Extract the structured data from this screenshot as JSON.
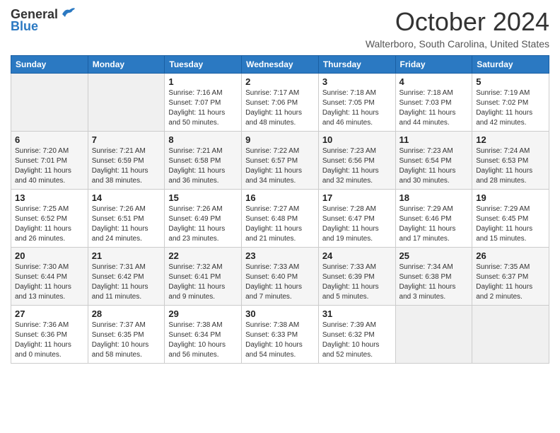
{
  "logo": {
    "general": "General",
    "blue": "Blue"
  },
  "title": "October 2024",
  "location": "Walterboro, South Carolina, United States",
  "days_of_week": [
    "Sunday",
    "Monday",
    "Tuesday",
    "Wednesday",
    "Thursday",
    "Friday",
    "Saturday"
  ],
  "weeks": [
    [
      {
        "day": "",
        "info": ""
      },
      {
        "day": "",
        "info": ""
      },
      {
        "day": "1",
        "info": "Sunrise: 7:16 AM\nSunset: 7:07 PM\nDaylight: 11 hours and 50 minutes."
      },
      {
        "day": "2",
        "info": "Sunrise: 7:17 AM\nSunset: 7:06 PM\nDaylight: 11 hours and 48 minutes."
      },
      {
        "day": "3",
        "info": "Sunrise: 7:18 AM\nSunset: 7:05 PM\nDaylight: 11 hours and 46 minutes."
      },
      {
        "day": "4",
        "info": "Sunrise: 7:18 AM\nSunset: 7:03 PM\nDaylight: 11 hours and 44 minutes."
      },
      {
        "day": "5",
        "info": "Sunrise: 7:19 AM\nSunset: 7:02 PM\nDaylight: 11 hours and 42 minutes."
      }
    ],
    [
      {
        "day": "6",
        "info": "Sunrise: 7:20 AM\nSunset: 7:01 PM\nDaylight: 11 hours and 40 minutes."
      },
      {
        "day": "7",
        "info": "Sunrise: 7:21 AM\nSunset: 6:59 PM\nDaylight: 11 hours and 38 minutes."
      },
      {
        "day": "8",
        "info": "Sunrise: 7:21 AM\nSunset: 6:58 PM\nDaylight: 11 hours and 36 minutes."
      },
      {
        "day": "9",
        "info": "Sunrise: 7:22 AM\nSunset: 6:57 PM\nDaylight: 11 hours and 34 minutes."
      },
      {
        "day": "10",
        "info": "Sunrise: 7:23 AM\nSunset: 6:56 PM\nDaylight: 11 hours and 32 minutes."
      },
      {
        "day": "11",
        "info": "Sunrise: 7:23 AM\nSunset: 6:54 PM\nDaylight: 11 hours and 30 minutes."
      },
      {
        "day": "12",
        "info": "Sunrise: 7:24 AM\nSunset: 6:53 PM\nDaylight: 11 hours and 28 minutes."
      }
    ],
    [
      {
        "day": "13",
        "info": "Sunrise: 7:25 AM\nSunset: 6:52 PM\nDaylight: 11 hours and 26 minutes."
      },
      {
        "day": "14",
        "info": "Sunrise: 7:26 AM\nSunset: 6:51 PM\nDaylight: 11 hours and 24 minutes."
      },
      {
        "day": "15",
        "info": "Sunrise: 7:26 AM\nSunset: 6:49 PM\nDaylight: 11 hours and 23 minutes."
      },
      {
        "day": "16",
        "info": "Sunrise: 7:27 AM\nSunset: 6:48 PM\nDaylight: 11 hours and 21 minutes."
      },
      {
        "day": "17",
        "info": "Sunrise: 7:28 AM\nSunset: 6:47 PM\nDaylight: 11 hours and 19 minutes."
      },
      {
        "day": "18",
        "info": "Sunrise: 7:29 AM\nSunset: 6:46 PM\nDaylight: 11 hours and 17 minutes."
      },
      {
        "day": "19",
        "info": "Sunrise: 7:29 AM\nSunset: 6:45 PM\nDaylight: 11 hours and 15 minutes."
      }
    ],
    [
      {
        "day": "20",
        "info": "Sunrise: 7:30 AM\nSunset: 6:44 PM\nDaylight: 11 hours and 13 minutes."
      },
      {
        "day": "21",
        "info": "Sunrise: 7:31 AM\nSunset: 6:42 PM\nDaylight: 11 hours and 11 minutes."
      },
      {
        "day": "22",
        "info": "Sunrise: 7:32 AM\nSunset: 6:41 PM\nDaylight: 11 hours and 9 minutes."
      },
      {
        "day": "23",
        "info": "Sunrise: 7:33 AM\nSunset: 6:40 PM\nDaylight: 11 hours and 7 minutes."
      },
      {
        "day": "24",
        "info": "Sunrise: 7:33 AM\nSunset: 6:39 PM\nDaylight: 11 hours and 5 minutes."
      },
      {
        "day": "25",
        "info": "Sunrise: 7:34 AM\nSunset: 6:38 PM\nDaylight: 11 hours and 3 minutes."
      },
      {
        "day": "26",
        "info": "Sunrise: 7:35 AM\nSunset: 6:37 PM\nDaylight: 11 hours and 2 minutes."
      }
    ],
    [
      {
        "day": "27",
        "info": "Sunrise: 7:36 AM\nSunset: 6:36 PM\nDaylight: 11 hours and 0 minutes."
      },
      {
        "day": "28",
        "info": "Sunrise: 7:37 AM\nSunset: 6:35 PM\nDaylight: 10 hours and 58 minutes."
      },
      {
        "day": "29",
        "info": "Sunrise: 7:38 AM\nSunset: 6:34 PM\nDaylight: 10 hours and 56 minutes."
      },
      {
        "day": "30",
        "info": "Sunrise: 7:38 AM\nSunset: 6:33 PM\nDaylight: 10 hours and 54 minutes."
      },
      {
        "day": "31",
        "info": "Sunrise: 7:39 AM\nSunset: 6:32 PM\nDaylight: 10 hours and 52 minutes."
      },
      {
        "day": "",
        "info": ""
      },
      {
        "day": "",
        "info": ""
      }
    ]
  ]
}
